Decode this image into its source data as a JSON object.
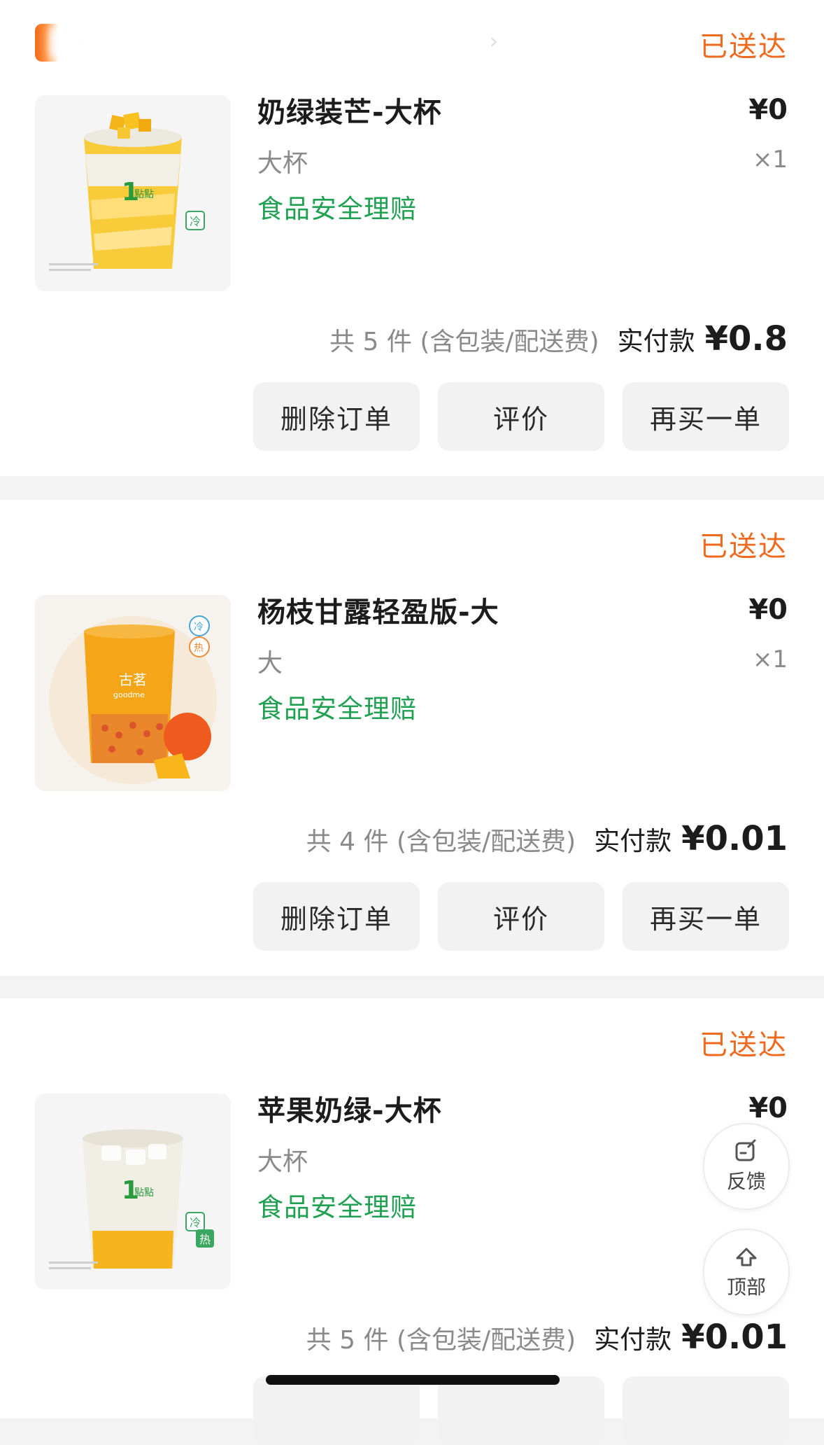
{
  "orders": [
    {
      "status": "已送达",
      "item": {
        "name": "奶绿装芒-大杯",
        "spec": "大杯",
        "claim": "食品安全理赔",
        "price": "¥0",
        "qty": "×1",
        "temp_badges": [
          "冷"
        ]
      },
      "summary": {
        "count": "共 5 件 (含包装/配送费)",
        "label": "实付款",
        "total": "¥0.8"
      },
      "actions": [
        "删除订单",
        "评价",
        "再买一单"
      ]
    },
    {
      "status": "已送达",
      "item": {
        "name": "杨枝甘露轻盈版-大",
        "spec": "大",
        "claim": "食品安全理赔",
        "price": "¥0",
        "qty": "×1",
        "temp_badges": [
          "冷",
          "热"
        ],
        "cup_text": "古茗",
        "cup_subtext": "goodme"
      },
      "summary": {
        "count": "共 4 件 (含包装/配送费)",
        "label": "实付款",
        "total": "¥0.01"
      },
      "actions": [
        "删除订单",
        "评价",
        "再买一单"
      ]
    },
    {
      "status": "已送达",
      "item": {
        "name": "苹果奶绿-大杯",
        "spec": "大杯",
        "claim": "食品安全理赔",
        "price": "¥0",
        "qty": "",
        "temp_badges": [
          "冷",
          "热"
        ]
      },
      "summary": {
        "count": "共 5 件 (含包装/配送费)",
        "label": "实付款",
        "total": "¥0.01"
      },
      "actions": []
    }
  ],
  "float_buttons": {
    "feedback": "反馈",
    "top": "顶部"
  },
  "colors": {
    "status_orange": "#ee6a1f",
    "claim_green": "#20a151",
    "button_bg": "#f2f2f2"
  }
}
